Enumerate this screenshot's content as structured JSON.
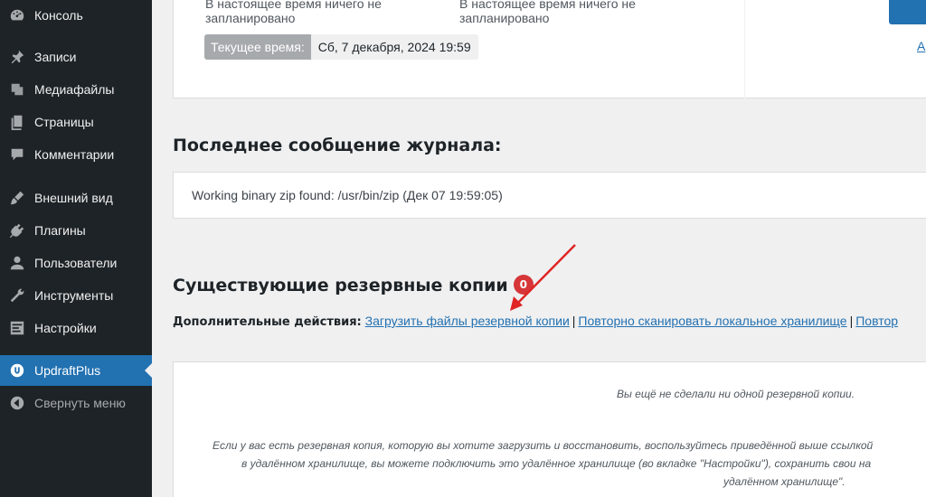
{
  "sidebar": {
    "items": [
      {
        "label": "Консоль",
        "icon": "dashboard-icon"
      },
      {
        "label": "Записи",
        "icon": "pin-icon"
      },
      {
        "label": "Медиафайлы",
        "icon": "media-icon"
      },
      {
        "label": "Страницы",
        "icon": "pages-icon"
      },
      {
        "label": "Комментарии",
        "icon": "comment-icon"
      },
      {
        "label": "Внешний вид",
        "icon": "brush-icon"
      },
      {
        "label": "Плагины",
        "icon": "plugin-icon"
      },
      {
        "label": "Пользователи",
        "icon": "user-icon"
      },
      {
        "label": "Инструменты",
        "icon": "wrench-icon"
      },
      {
        "label": "Настройки",
        "icon": "settings-icon"
      },
      {
        "label": "UpdraftPlus",
        "icon": "updraft-icon"
      },
      {
        "label": "Свернуть меню",
        "icon": "collapse-icon"
      }
    ]
  },
  "schedule": {
    "files_status": "В настоящее время ничего не запланировано",
    "db_status": "В настоящее время ничего не запланировано",
    "current_time_label": "Текущее время:",
    "current_time_value": "Сб, 7 декабря, 2024 19:59",
    "right_link": "A"
  },
  "log": {
    "heading": "Последнее сообщение журнала:",
    "message": "Working binary zip found: /usr/bin/zip (Дек 07 19:59:05)"
  },
  "backups": {
    "heading": "Существующие резервные копии",
    "count": "0",
    "actions_label": "Дополнительные действия:",
    "actions": [
      "Загрузить файлы резервной копии",
      "Повторно сканировать локальное хранилище",
      "Повтор"
    ],
    "empty_title": "Вы ещё не сделали ни одной резервной копии.",
    "empty_line1": "Если у вас есть резервная копия, которую вы хотите загрузить и восстановить, воспользуйтесь приведённой выше ссылкой",
    "empty_line2": "в удалённом хранилище, вы можете подключить это удалённое хранилище (во вкладке \"Настройки\"), сохранить свои на",
    "empty_line3": "удалённом хранилище\"."
  },
  "colors": {
    "sidebar_bg": "#1d2327",
    "accent": "#2271b1",
    "badge": "#d63638",
    "arrow": "#e02424"
  }
}
